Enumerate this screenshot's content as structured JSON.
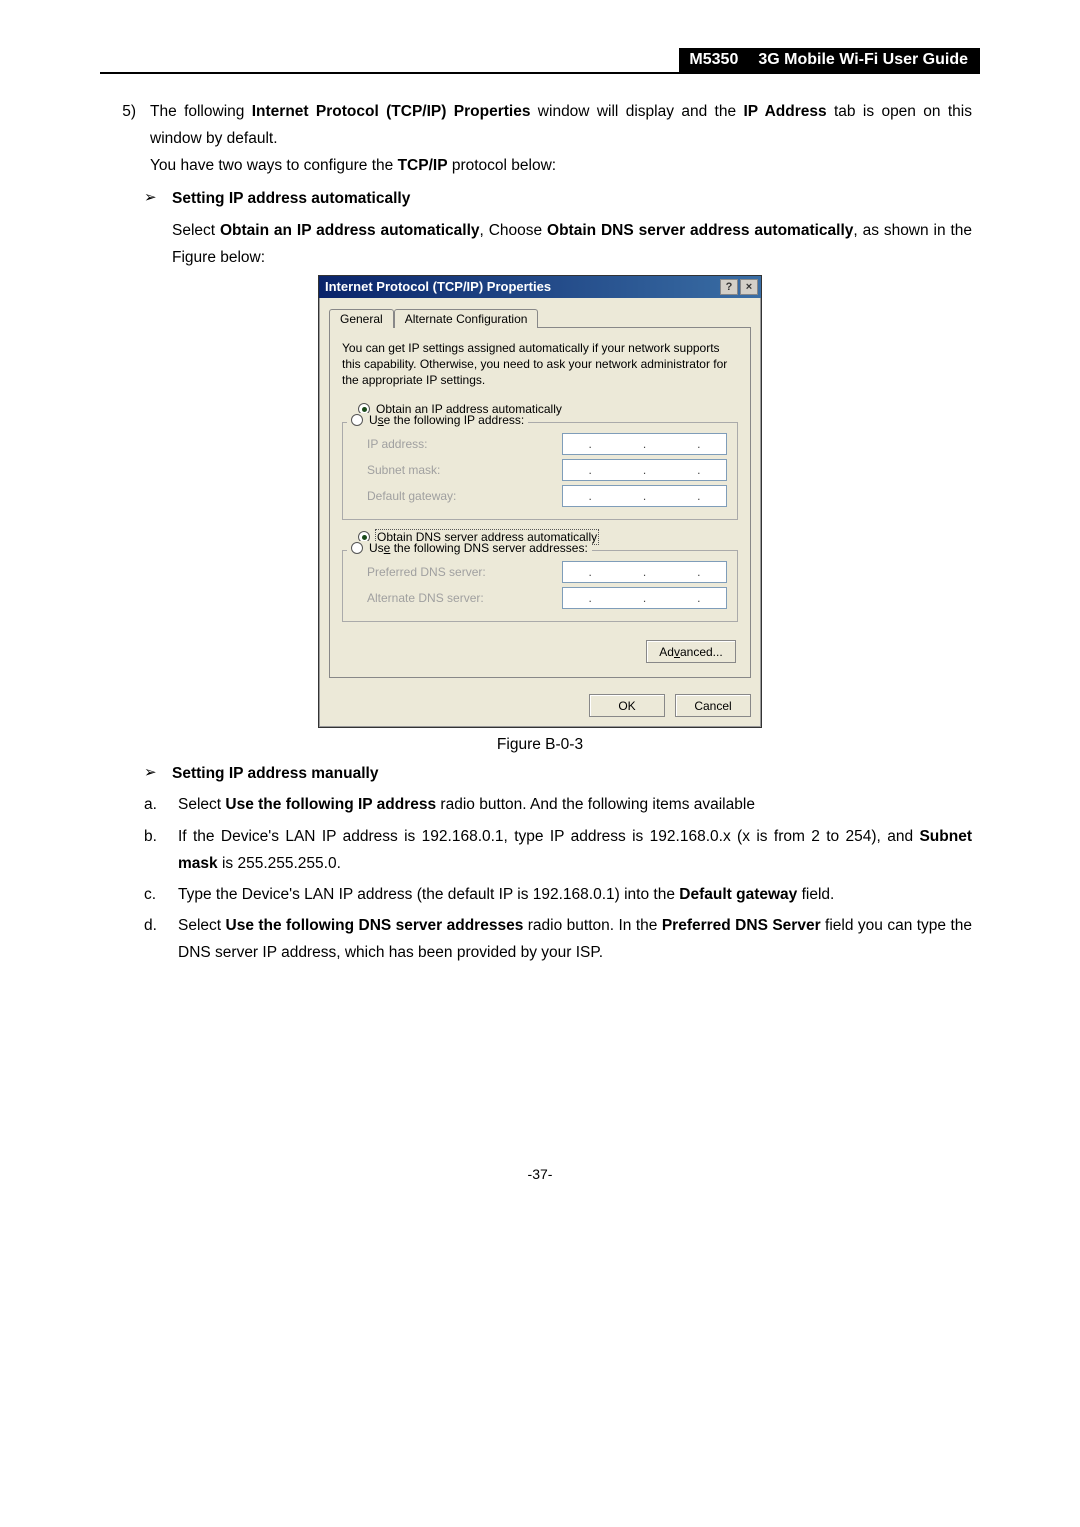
{
  "header": {
    "model": "M5350",
    "title": "3G Mobile Wi-Fi User Guide"
  },
  "step": {
    "number": "5)",
    "para1": {
      "pre": "The following ",
      "b1": "Internet Protocol (TCP/IP) Properties",
      "mid": " window will display and the ",
      "b2": "IP Address",
      "post": " tab is open on this window by default."
    },
    "para2": {
      "pre": "You have two ways to configure the ",
      "b": "TCP/IP",
      "post": " protocol below:"
    }
  },
  "auto_heading": "Setting IP address automatically",
  "auto_text": {
    "pre": "Select ",
    "b1": "Obtain an IP address automatically",
    "mid": ", Choose ",
    "b2": "Obtain DNS server address automatically",
    "post": ", as shown in the Figure below:"
  },
  "dialog": {
    "title": "Internet Protocol (TCP/IP) Properties",
    "help": "?",
    "close": "×",
    "tab_general": "General",
    "tab_alt": "Alternate Configuration",
    "description": "You can get IP settings assigned automatically if your network supports this capability. Otherwise, you need to ask your network administrator for the appropriate IP settings.",
    "ip_auto": "btain an IP address automatically",
    "ip_auto_u": "O",
    "ip_manual": "e the following IP address:",
    "ip_manual_u": "s",
    "ip_manual_pre": "U",
    "ip_address": "IP address:",
    "subnet": "Subnet mask:",
    "gateway": "Default gateway:",
    "dns_auto": "tain DNS server address automatically",
    "dns_auto_u": "b",
    "dns_auto_pre": "O",
    "dns_manual": " the following DNS server addresses:",
    "dns_manual_u": "e",
    "dns_manual_pre": "Us",
    "preferred_dns": "Preferred DNS server:",
    "alternate_dns": "Alternate DNS server:",
    "advanced": "Advanced...",
    "advanced_u": "v",
    "ok": "OK",
    "cancel": "Cancel"
  },
  "figure_caption": "Figure B-0-3",
  "manual_heading": "Setting IP address manually",
  "items": {
    "a": {
      "letter": "a.",
      "pre": "Select ",
      "b": "Use the following IP address",
      "post": " radio button. And the following items available"
    },
    "b": {
      "letter": "b.",
      "pre": "If the Device's LAN IP address is 192.168.0.1, type IP address is 192.168.0.x (x is from 2 to 254), and ",
      "b": "Subnet mask",
      "post": " is 255.255.255.0."
    },
    "c": {
      "letter": "c.",
      "pre": "Type the Device's LAN IP address (the default IP is 192.168.0.1) into the ",
      "b": "Default gateway",
      "post": " field."
    },
    "d": {
      "letter": "d.",
      "pre": "Select ",
      "b1": "Use the following DNS server addresses",
      "mid": " radio button. In the ",
      "b2": "Preferred DNS Server",
      "post": " field you can type the DNS server IP address, which has been provided by your ISP."
    }
  },
  "page_number": "-37-"
}
